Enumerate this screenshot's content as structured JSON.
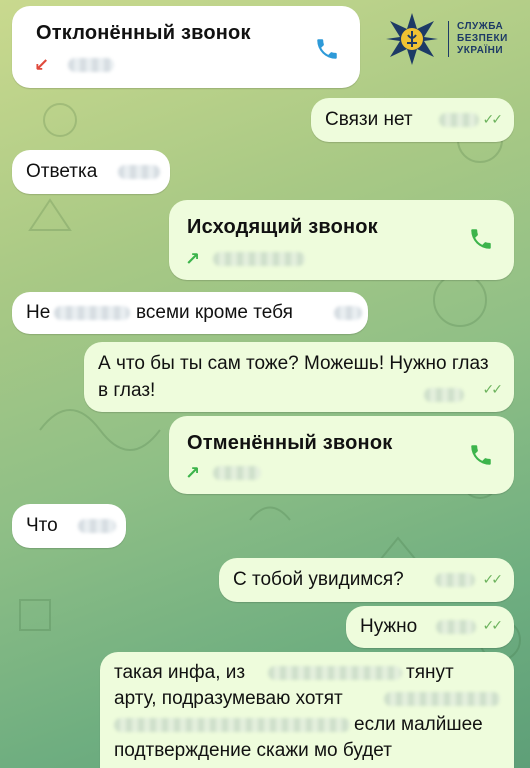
{
  "badge": {
    "line1": "СЛУЖБА",
    "line2": "БЕЗПЕКИ",
    "line3": "УКРАЇНИ"
  },
  "messages": {
    "m1": {
      "title": "Отклонённый звонок",
      "arrow": "↙"
    },
    "m2": {
      "text": "Связи нет"
    },
    "m3": {
      "text": "Ответка"
    },
    "m4": {
      "title": "Исходящий звонок",
      "arrow": "↗"
    },
    "m5": {
      "text_a": "Не",
      "text_b": "всеми кроме тебя"
    },
    "m6": {
      "text": "А что бы ты сам тоже? Можешь! Нужно глаз в глаз!"
    },
    "m7": {
      "title": "Отменённый звонок",
      "arrow": "↗"
    },
    "m8": {
      "text": "Что"
    },
    "m9": {
      "text": "С тобой увидимся?"
    },
    "m10": {
      "text": "Нужно"
    },
    "m11": {
      "line1_a": "такая инфа, из",
      "line1_b": "тянут",
      "line2": "арту, подразумеваю хотят",
      "line3": "если малйшее",
      "line4": "подтверждение скажи мо будет"
    }
  },
  "colors": {
    "accent_green": "#3cb44b",
    "call_icon": "#2e9ad8",
    "missed": "#e04a3c"
  }
}
